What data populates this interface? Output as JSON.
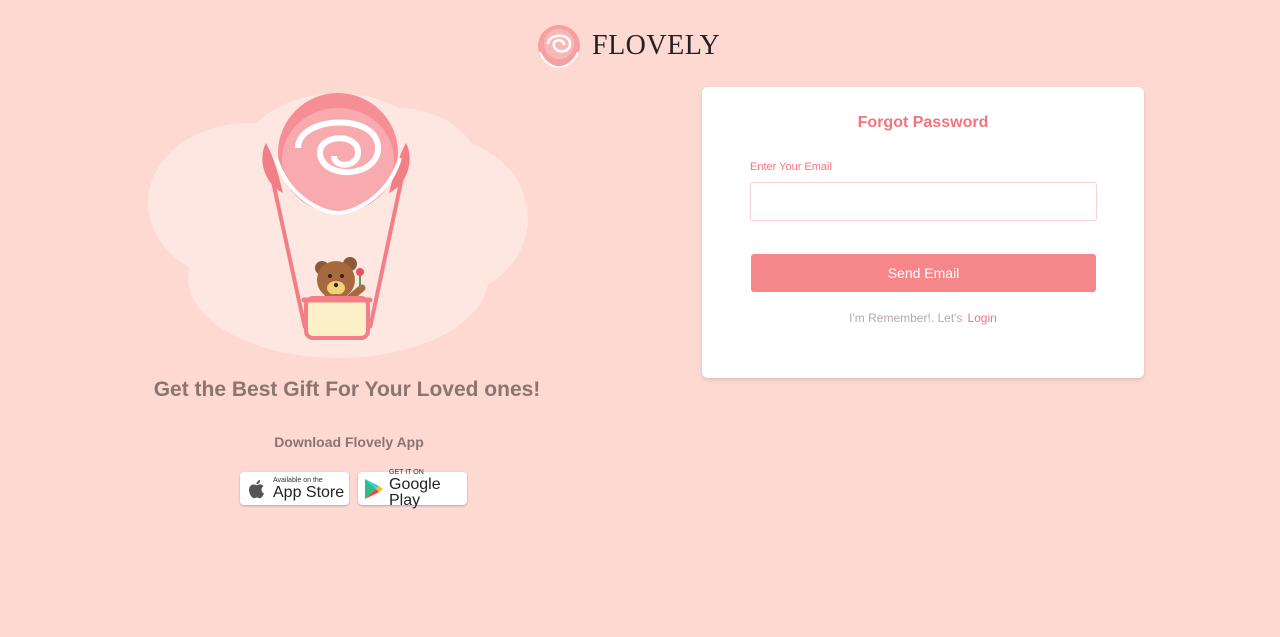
{
  "brand": {
    "name": "FLOVELY",
    "logo_icon": "rose-logo-icon"
  },
  "hero": {
    "illustration": "rose-hot-air-balloon-teddy-bear",
    "tagline": "Get the Best Gift For Your Loved ones!",
    "download_label": "Download Flovely App"
  },
  "stores": {
    "appstore": {
      "small": "Available on the",
      "big": "App Store",
      "icon": "apple-icon"
    },
    "googleplay": {
      "small": "GET IT ON",
      "big": "Google Play",
      "icon": "google-play-icon"
    }
  },
  "forgot": {
    "title": "Forgot Password",
    "email_label": "Enter Your Email",
    "email_value": "",
    "email_placeholder": "",
    "send_button": "Send Email",
    "remember_text": "I'm Remember!. Let's",
    "login_link": "Login"
  },
  "colors": {
    "background": "#fed9d2",
    "accent": "#f3747d",
    "button": "#f5868a"
  }
}
